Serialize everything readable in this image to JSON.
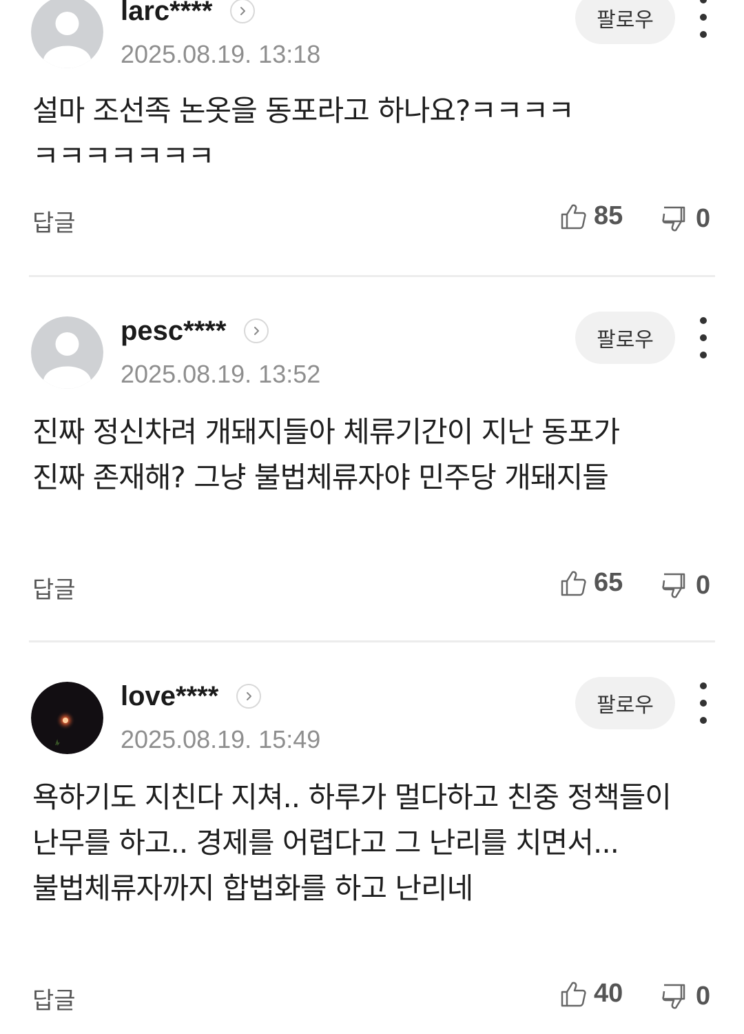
{
  "comments": [
    {
      "username": "larc****",
      "timestamp": "2025.08.19. 13:18",
      "follow_label": "팔로우",
      "text": "설마 조선족 논옷을 동포라고 하나요?ㅋㅋㅋㅋ ㅋㅋㅋㅋㅋㅋㅋ",
      "reply_label": "답글",
      "likes": "85",
      "dislikes": "0",
      "avatar": "default-person"
    },
    {
      "username": "pesc****",
      "timestamp": "2025.08.19. 13:52",
      "follow_label": "팔로우",
      "text": "진짜 정신차려 개돼지들아 체류기간이 지난 동포가 진짜 존재해? 그냥 불법체류자야 민주당 개돼지들",
      "reply_label": "답글",
      "likes": "65",
      "dislikes": "0",
      "avatar": "default-person"
    },
    {
      "username": "love****",
      "timestamp": "2025.08.19. 15:49",
      "follow_label": "팔로우",
      "text": "욕하기도 지친다 지쳐.. 하루가 멀다하고 친중 정책들이 난무를 하고.. 경제를 어렵다고 그 난리를 치면서... 불법체류자까지 합법화를 하고 난리네",
      "reply_label": "답글",
      "likes": "40",
      "dislikes": "0",
      "avatar": "dark-photo-moon"
    }
  ],
  "icons": {
    "like": "thumbs-up-icon",
    "dislike": "thumbs-down-icon",
    "more": "more-vertical-icon",
    "profile": "chevron-right-icon"
  },
  "colors": {
    "follow_bg": "#f1f1f1",
    "muted_text": "#8e8e8e",
    "divider": "#ececec"
  }
}
